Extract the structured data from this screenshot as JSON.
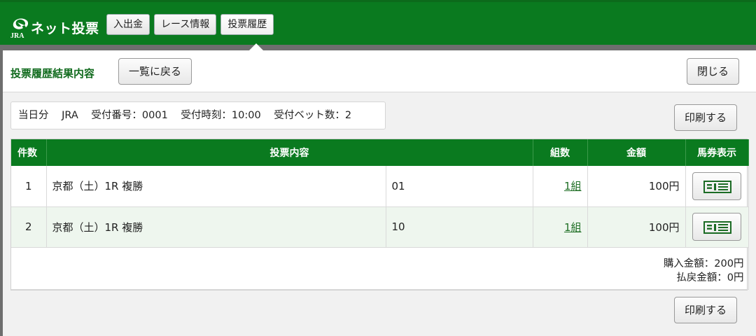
{
  "header": {
    "brand_sub": "JRA",
    "brand": "ネット投票",
    "nav": [
      "入出金",
      "レース情報",
      "投票履歴"
    ]
  },
  "panel": {
    "title": "投票履歴結果内容",
    "back_label": "一覧に戻る",
    "close_label": "閉じる",
    "print_label": "印刷する"
  },
  "summary": {
    "day": "当日分",
    "org": "JRA",
    "receipt_no": "受付番号：0001",
    "receipt_time": "受付時刻：10:00",
    "bet_count": "受付ベット数：2"
  },
  "table": {
    "headers": [
      "件数",
      "投票内容",
      "組数",
      "金額",
      "馬券表示"
    ],
    "rows": [
      {
        "no": "1",
        "race": "京都（土）1R 複勝",
        "selection": "01",
        "combos": "1組",
        "amount": "100円"
      },
      {
        "no": "2",
        "race": "京都（土）1R 複勝",
        "selection": "10",
        "combos": "1組",
        "amount": "100円"
      }
    ],
    "purchase_total": "購入金額：200円",
    "refund_total": "払戻金額：0円"
  },
  "colors": {
    "header_green": "#0a7a1f",
    "title_green": "#116b1e"
  }
}
